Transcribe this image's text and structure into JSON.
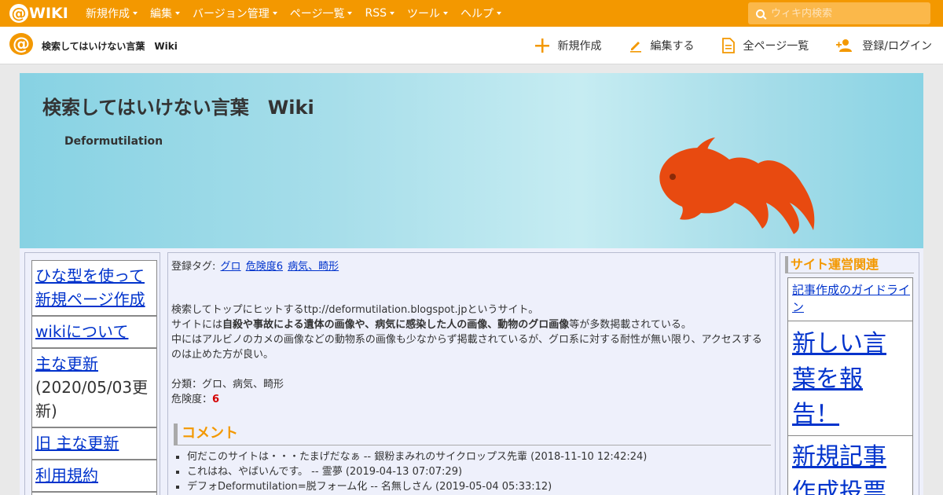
{
  "topbar": {
    "logo_at": "@",
    "logo_text": "WIKI",
    "nav": [
      "新規作成",
      "編集",
      "バージョン管理",
      "ページ一覧",
      "RSS",
      "ツール",
      "ヘルプ"
    ],
    "search_placeholder": "ウィキ内検索"
  },
  "subbar": {
    "logo_at": "@",
    "site_title": "検索してはいけない言葉　Wiki",
    "actions": [
      "新規作成",
      "編集する",
      "全ページ一覧",
      "登録/ログイン"
    ]
  },
  "header": {
    "title": "検索してはいけない言葉　Wiki",
    "subtitle": "Deformutilation"
  },
  "left_menu": [
    {
      "text": "ひな型を使って新規ページ作成",
      "link": true
    },
    {
      "text": "wikiについて",
      "link": true
    },
    {
      "text": "主な更新",
      "link": true,
      "extra": "(2020/05/03更新)"
    },
    {
      "text": "旧 主な更新",
      "link": true
    },
    {
      "text": "利用規約",
      "link": true
    }
  ],
  "main": {
    "tags_label": "登録タグ:",
    "tags": [
      "グロ",
      "危険度6",
      "病気、畸形"
    ],
    "para1": "検索してトップにヒットするttp://deformutilation.blogspot.jpというサイト。",
    "para2_pre": "サイトには",
    "para2_bold": "自殺や事故による遺体の画像や、病気に感染した人の画像、動物のグロ画像",
    "para2_post": "等が多数掲載されている。",
    "para3": "中にはアルビノのカメの画像などの動物系の画像も少なからず掲載されているが、グロ系に対する耐性が無い限り、アクセスするのは止めた方が良い。",
    "category": "分類：グロ、病気、畸形",
    "danger_label": "危険度：",
    "danger_value": "6",
    "comment_heading": "コメント",
    "comments": [
      "何だこのサイトは・・・たまげだなぁ -- 銀粉まみれのサイクロップス先輩 (2018-11-10 12:42:24)",
      "これはね、やばいんです。 -- 霊夢 (2019-04-13 07:07:29)",
      "デフォDeformutilation=脱フォーム化 -- 名無しさん (2019-05-04 05:33:12)"
    ]
  },
  "right_menu": {
    "heading": "サイト運営関連",
    "items": [
      "記事作成のガイドライン",
      "新しい言葉を報告！",
      "新規記事作成投票"
    ]
  },
  "colors": {
    "accent": "#f39800",
    "link": "#0033cc",
    "danger": "#d40000"
  }
}
